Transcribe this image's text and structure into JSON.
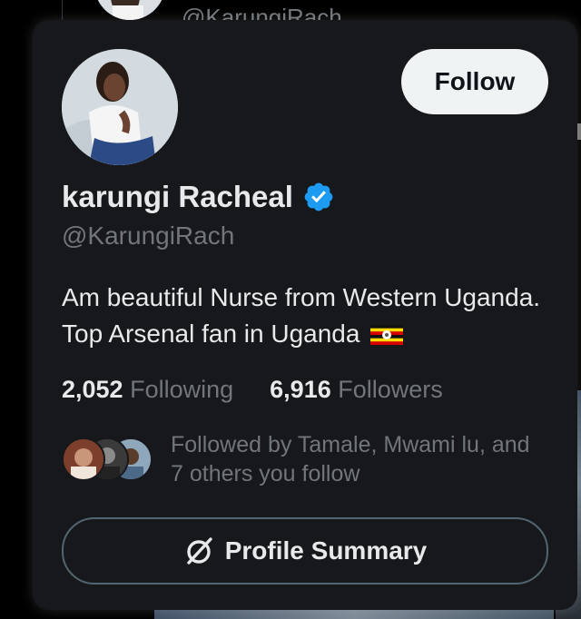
{
  "background": {
    "handle_partial": "@KarungiRach"
  },
  "card": {
    "follow_label": "Follow",
    "name": "karungi Racheal",
    "handle": "@KarungiRach",
    "bio": "Am beautiful Nurse from Western Uganda. Top Arsenal fan in Uganda",
    "following_count": "2,052",
    "following_label": "Following",
    "followers_count": "6,916",
    "followers_label": "Followers",
    "followed_by": "Followed by Tamale, Mwami lu, and 7 others you follow",
    "summary_label": "Profile Summary"
  },
  "colors": {
    "card_bg": "#16181c",
    "verified_blue": "#1d9bf0",
    "muted_text": "#71767b"
  },
  "icons": [
    "verified-badge-icon",
    "uganda-flag-icon",
    "grok-slash-icon"
  ]
}
